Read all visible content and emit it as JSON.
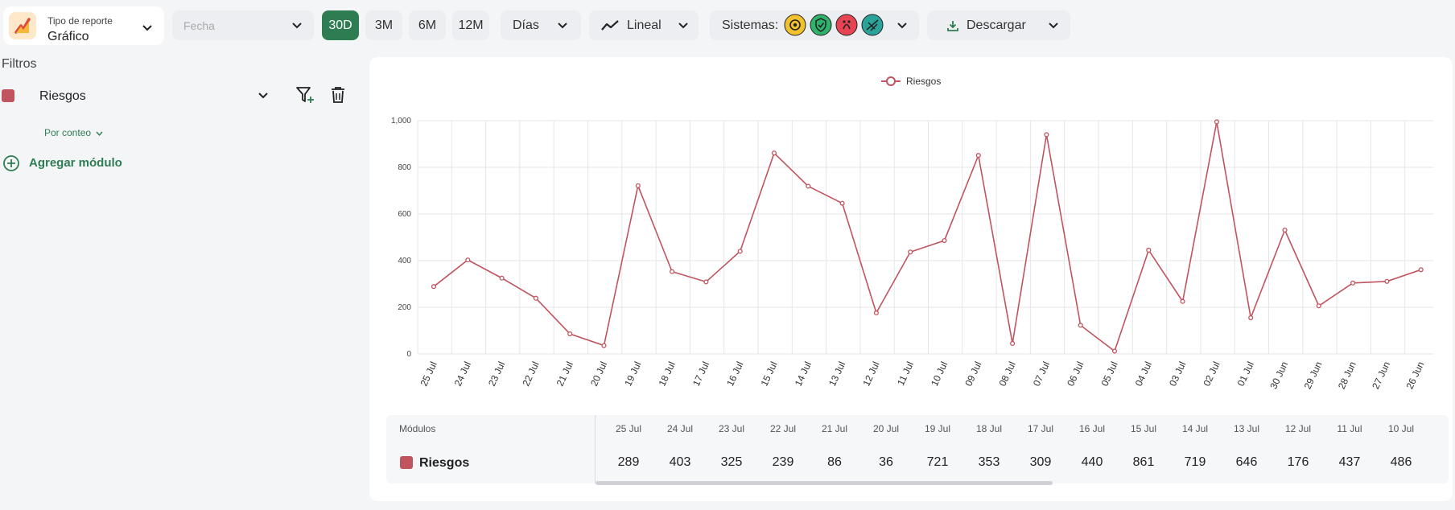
{
  "toolbar": {
    "report_type_label": "Tipo de reporte",
    "report_type_value": "Gráfico",
    "date_placeholder": "Fecha",
    "range_buttons": [
      "30D",
      "3M",
      "6M",
      "12M"
    ],
    "active_range": "30D",
    "granularity": "Días",
    "chart_style": "Lineal",
    "systems_label": "Sistemas:",
    "system_icons": [
      "gear-system-icon",
      "shield-check-system-icon",
      "bug-system-icon",
      "people-system-icon"
    ],
    "download_label": "Descargar"
  },
  "sidebar": {
    "title": "Filtros",
    "filter_label": "Riesgos",
    "filter_color": "#c0545f",
    "aggregation": "Por conteo",
    "add_module": "Agregar módulo"
  },
  "chart_data": {
    "type": "line",
    "legend": [
      "Riesgos"
    ],
    "series": [
      {
        "name": "Riesgos",
        "color": "#c0545f",
        "values": [
          289,
          403,
          325,
          239,
          86,
          36,
          721,
          353,
          309,
          440,
          861,
          719,
          646,
          176,
          437,
          486,
          851,
          45,
          940,
          123,
          12,
          445,
          225,
          995,
          155,
          531,
          206,
          304,
          311,
          361
        ]
      }
    ],
    "categories": [
      "25 Jul",
      "24 Jul",
      "23 Jul",
      "22 Jul",
      "21 Jul",
      "20 Jul",
      "19 Jul",
      "18 Jul",
      "17 Jul",
      "16 Jul",
      "15 Jul",
      "14 Jul",
      "13 Jul",
      "12 Jul",
      "11 Jul",
      "10 Jul",
      "09 Jul",
      "08 Jul",
      "07 Jul",
      "06 Jul",
      "05 Jul",
      "04 Jul",
      "03 Jul",
      "02 Jul",
      "01 Jul",
      "30 Jun",
      "29 Jun",
      "28 Jun",
      "27 Jun",
      "26 Jun"
    ],
    "y_ticks": [
      "0",
      "200",
      "400",
      "600",
      "800",
      "1,000"
    ],
    "ylim": [
      0,
      1000
    ],
    "grid": true,
    "legend_position": "top-center"
  },
  "table": {
    "module_header": "Módulos",
    "row_label": "Riesgos",
    "dates": [
      "25 Jul",
      "24 Jul",
      "23 Jul",
      "22 Jul",
      "21 Jul",
      "20 Jul",
      "19 Jul",
      "18 Jul",
      "17 Jul",
      "16 Jul",
      "15 Jul",
      "14 Jul",
      "13 Jul",
      "12 Jul",
      "11 Jul",
      "10 Jul"
    ],
    "values": [
      "289",
      "403",
      "325",
      "239",
      "86",
      "36",
      "721",
      "353",
      "309",
      "440",
      "861",
      "719",
      "646",
      "176",
      "437",
      "486"
    ]
  }
}
